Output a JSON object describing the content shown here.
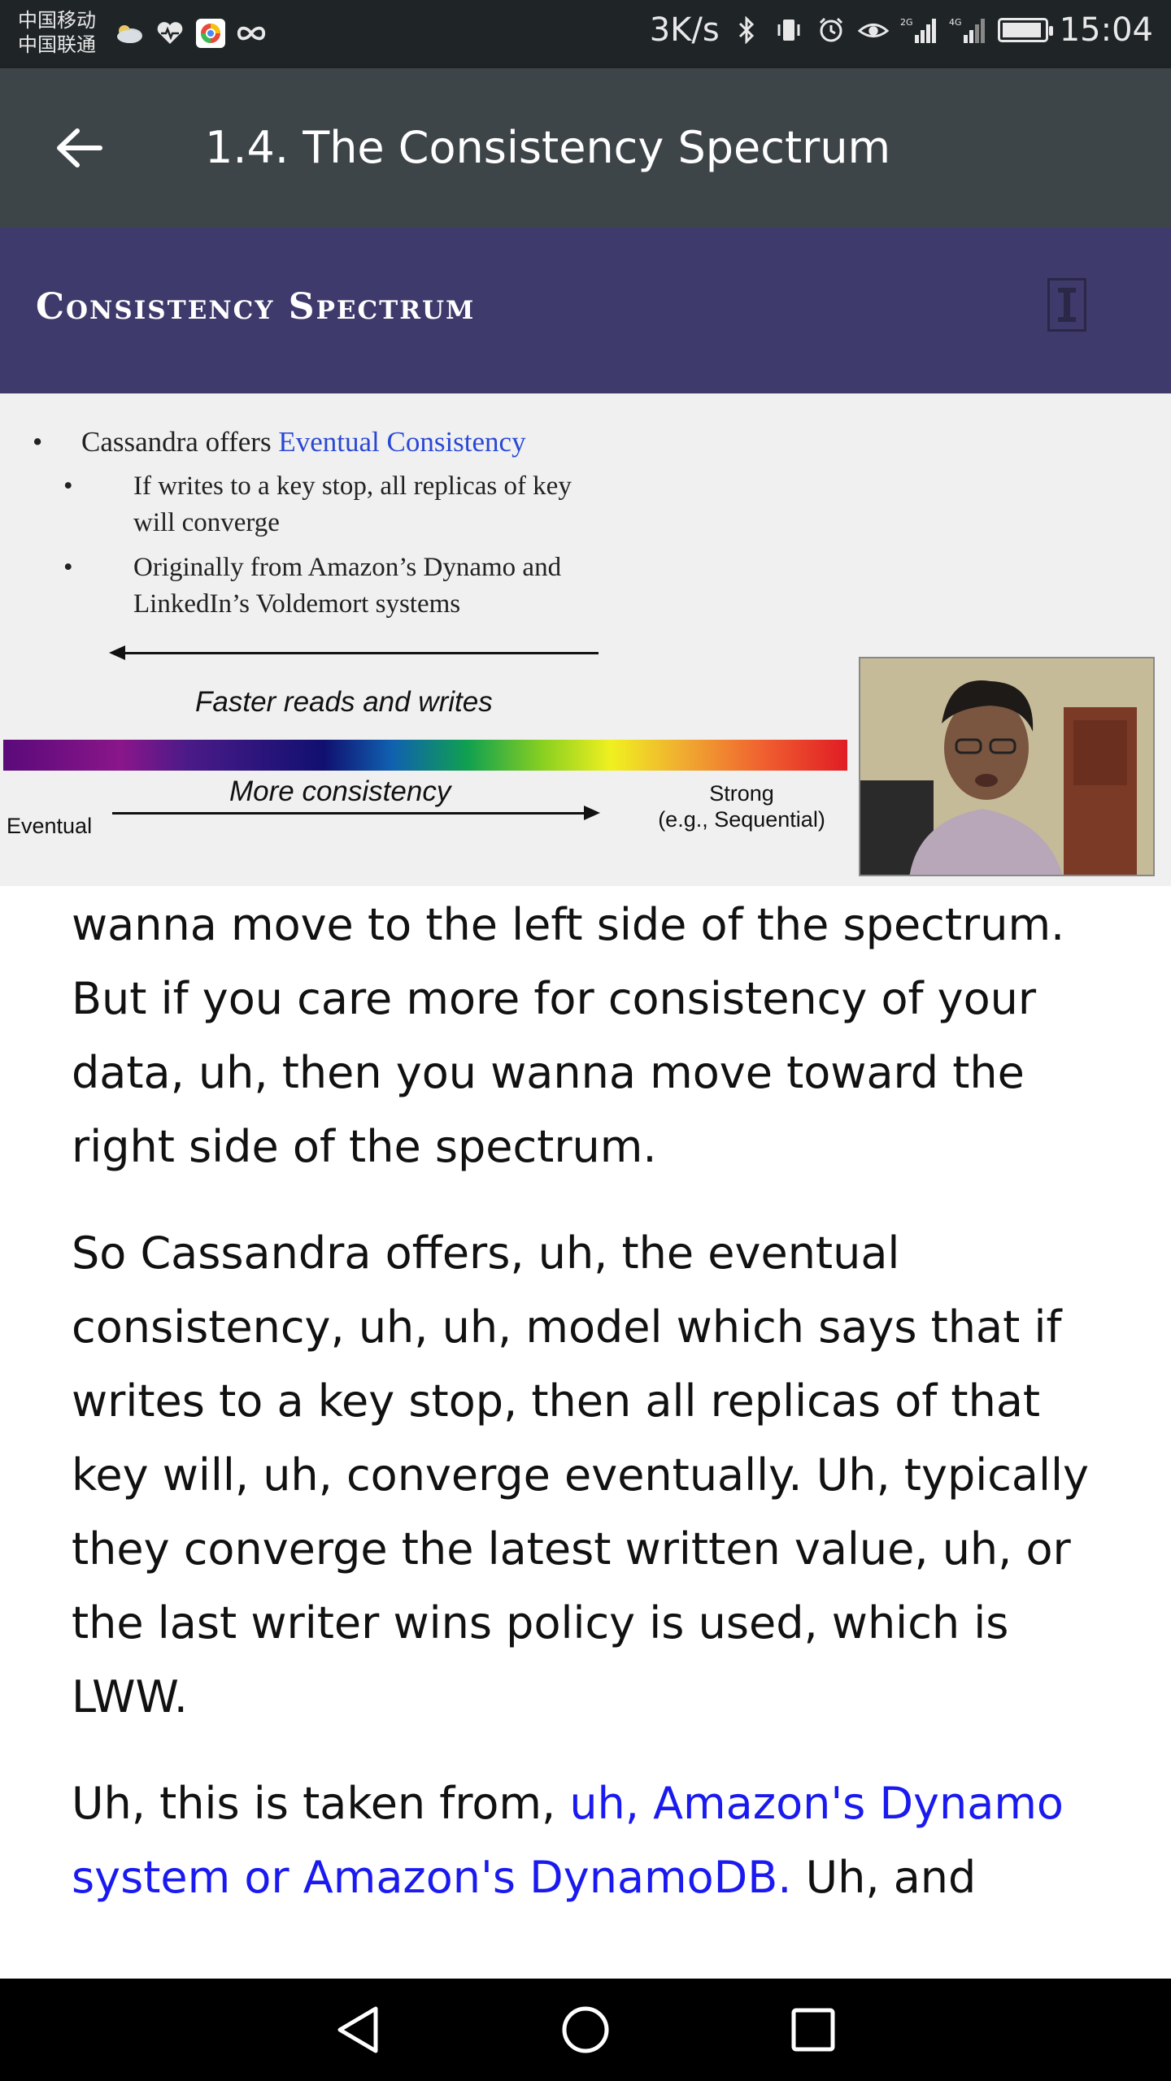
{
  "status_bar": {
    "carriers": [
      "中国移动",
      "中国联通"
    ],
    "network_speed": "3K/s",
    "network_types": [
      "2G",
      "4G"
    ],
    "time": "15:04",
    "battery_level": 0.95,
    "icons": [
      "weather-cloud-icon",
      "health-heart-icon",
      "browser-app-icon",
      "infinity-icon",
      "bluetooth-icon",
      "vibrate-icon",
      "alarm-icon",
      "eye-care-icon",
      "signal-icon",
      "battery-icon"
    ]
  },
  "app_bar": {
    "title": "1.4. The Consistency Spectrum",
    "back_icon": "arrow-left-icon",
    "background": "#3e4549"
  },
  "slide": {
    "title": "Consistency Spectrum",
    "bullet_main_prefix": "Cassandra offers ",
    "bullet_main_highlight": "Eventual Consistency",
    "sub_bullets": [
      [
        "If writes to a key stop, all replicas of key",
        "will converge"
      ],
      [
        "Originally from Amazon’s Dynamo and",
        "LinkedIn’s Voldemort systems"
      ]
    ],
    "arrow_top_label": "Faster reads and writes",
    "arrow_bottom_label": "More consistency",
    "left_end_label": "Eventual",
    "right_end_label_1": "Strong",
    "right_end_label_2": "(e.g., Sequential)",
    "header_color": "#3f3a6c",
    "highlight_color": "#2a48d6"
  },
  "transcript": {
    "para1": "wanna move to the left side of the spectrum. But if you care more for consistency of your data, uh, then you wanna move toward the right side of the spectrum.",
    "para2": "So Cassandra offers, uh, the eventual consistency, uh, uh, model which says that if writes to a key stop, then all replicas of that key will, uh, converge eventually. Uh, typically they converge the latest written value, uh, or the last writer wins policy is used, which is LWW.",
    "para3_prefix": "Uh, this is taken from, ",
    "para3_link": "uh, Amazon's Dynamo system or Amazon's DynamoDB.",
    "para3_suffix": " Uh, and",
    "link_color": "#1a1af0"
  },
  "nav_bar": {
    "buttons": [
      "back-triangle-icon",
      "home-circle-icon",
      "recents-square-icon"
    ]
  }
}
